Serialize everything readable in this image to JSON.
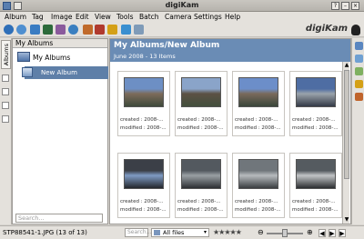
{
  "window": {
    "title": "digiKam"
  },
  "menu": [
    "Album",
    "Tag",
    "Image",
    "Edit",
    "View",
    "Tools",
    "Batch",
    "Camera",
    "Settings",
    "Help"
  ],
  "branding": {
    "logo_text": "digiKam"
  },
  "left_tabs": {
    "albums_label": "Albums"
  },
  "albums_panel": {
    "header": "My Albums",
    "root_label": "My Albums",
    "selected_album": "New Album",
    "search_placeholder": "Search..."
  },
  "main": {
    "title": "My Albums/New Album",
    "subtitle": "June 2008 - 13 Items",
    "thumbnails": [
      {
        "created": "created : 2008-...",
        "modified": "modified : 2008-...",
        "colors": [
          "#6d8fc4",
          "#7d6b5b",
          "#3f4a3b"
        ]
      },
      {
        "created": "created : 2008-...",
        "modified": "modified : 2008-...",
        "colors": [
          "#8aa4c9",
          "#5c5144",
          "#43503d"
        ]
      },
      {
        "created": "created : 2008-...",
        "modified": "modified : 2008-...",
        "colors": [
          "#6c8ec9",
          "#7a6a5c",
          "#3a463a"
        ]
      },
      {
        "created": "created : 2008-...",
        "modified": "modified : 2008-...",
        "colors": [
          "#4e6da3",
          "#9aa3ab",
          "#343a47"
        ]
      },
      {
        "created": "created : 2008-...",
        "modified": "modified : 2008-...",
        "colors": [
          "#3b3f47",
          "#7f9bc4",
          "#23262b"
        ]
      },
      {
        "created": "created : 2008-...",
        "modified": "modified : 2008-...",
        "colors": [
          "#53595f",
          "#9aa0a4",
          "#2c2f33"
        ]
      },
      {
        "created": "created : 2008-...",
        "modified": "modified : 2008-...",
        "colors": [
          "#70767b",
          "#b7bbbe",
          "#3a3d40"
        ]
      },
      {
        "created": "created : 2008-...",
        "modified": "modified : 2008-...",
        "colors": [
          "#555b60",
          "#c1c4c6",
          "#2b2d30"
        ]
      }
    ]
  },
  "status": {
    "file_info": "STP88541-1.JPG (13 of 13)",
    "search_placeholder": "Search...",
    "filter_value": "All files",
    "rating_stars": "★★★★★",
    "zoom_out": "⊖",
    "zoom_in": "⊕",
    "prev": "◀",
    "next": "▶",
    "last": "▶"
  },
  "icons": {
    "colors": [
      "#2f6fb8",
      "#4f8fd0",
      "#3a7cc2",
      "#2c6a3a",
      "#8a5a9c",
      "#3a7fc0",
      "#c06a2b",
      "#b03a2e",
      "#d4a017",
      "#3a8fd0",
      "#7f9bb8"
    ]
  }
}
